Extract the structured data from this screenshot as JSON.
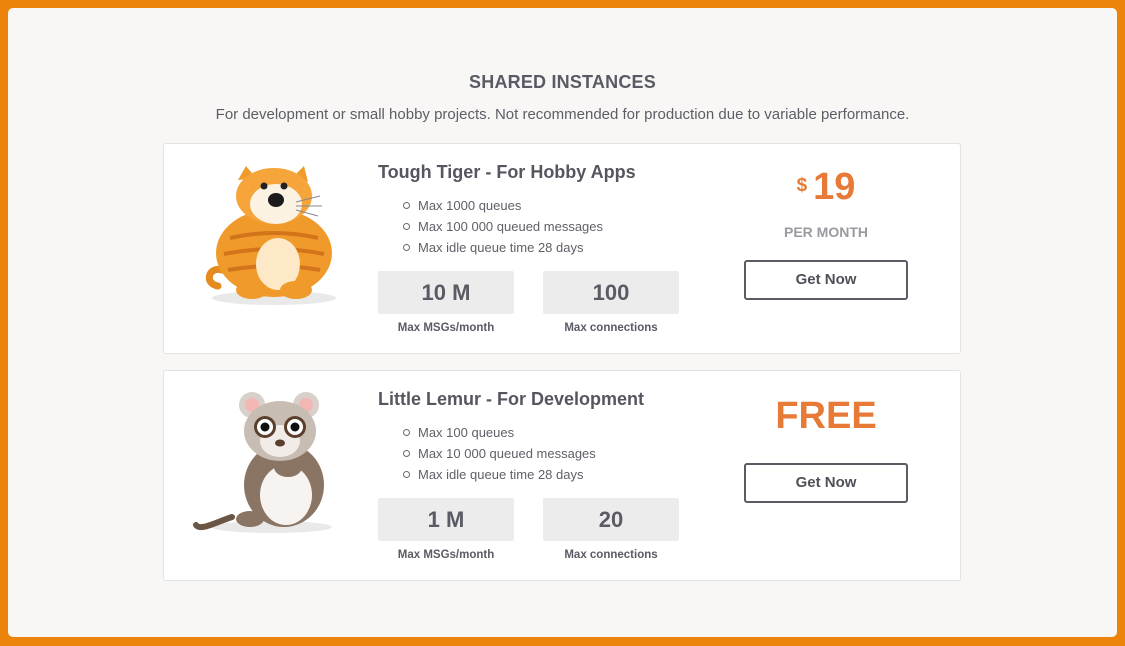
{
  "section": {
    "title": "SHARED INSTANCES",
    "description": "For development or small hobby projects. Not recommended for production due to variable performance."
  },
  "plans": [
    {
      "mascot": "tiger-mascot",
      "title": "Tough Tiger - For Hobby Apps",
      "features": [
        "Max 1000 queues",
        "Max 100 000 queued messages",
        "Max idle queue time 28 days"
      ],
      "stats": [
        {
          "value": "10 M",
          "label": "Max MSGs/month"
        },
        {
          "value": "100",
          "label": "Max connections"
        }
      ],
      "currency": "$",
      "price": "19",
      "period": "PER MONTH",
      "button": "Get Now"
    },
    {
      "mascot": "lemur-mascot",
      "title": "Little Lemur - For Development",
      "features": [
        "Max 100 queues",
        "Max 10 000 queued messages",
        "Max idle queue time 28 days"
      ],
      "stats": [
        {
          "value": "1 M",
          "label": "Max MSGs/month"
        },
        {
          "value": "20",
          "label": "Max connections"
        }
      ],
      "price": "FREE",
      "button": "Get Now"
    }
  ],
  "colors": {
    "frame": "#ec830a",
    "accent": "#e77a36",
    "text": "#5a5b64"
  }
}
